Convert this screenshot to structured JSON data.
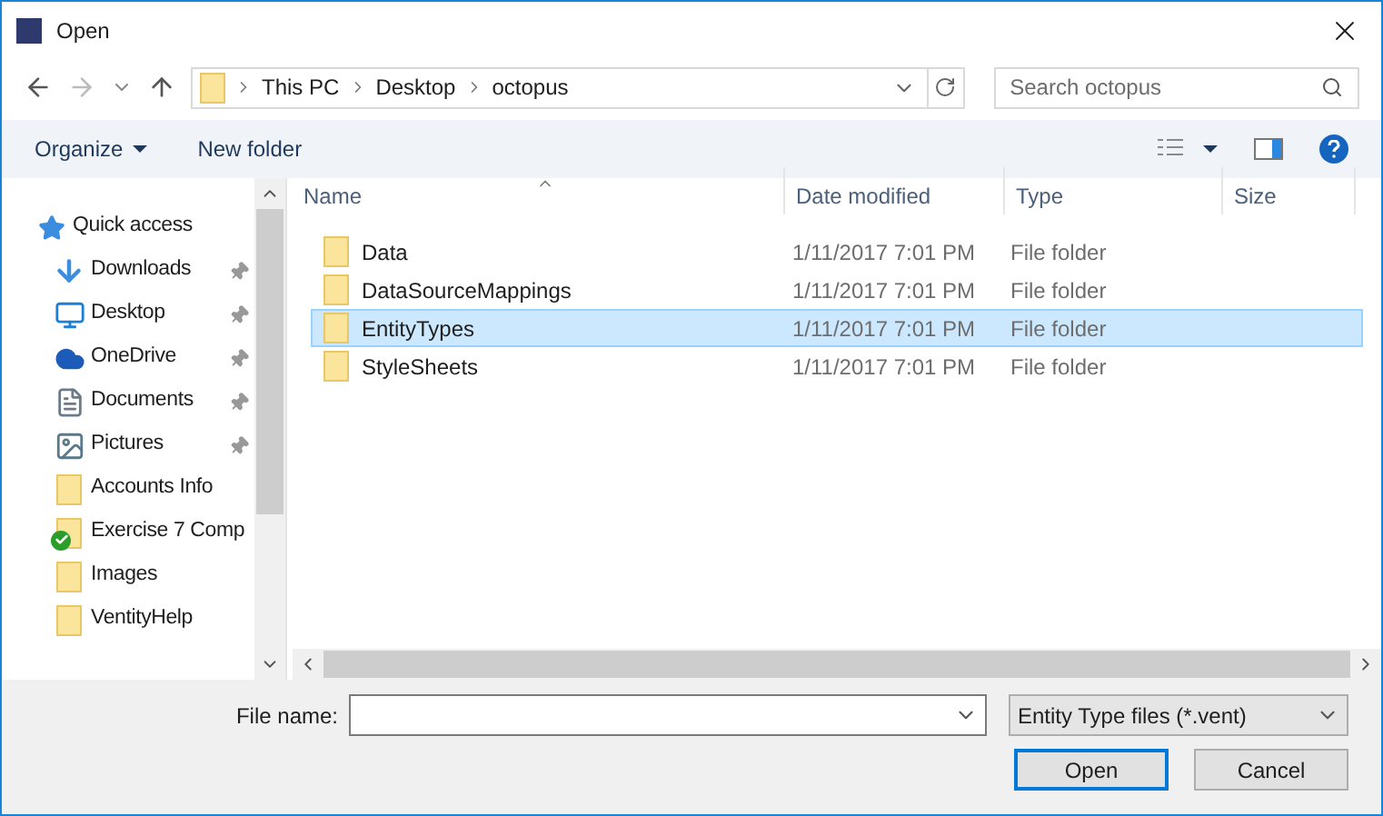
{
  "window": {
    "title": "Open"
  },
  "address_bar": {
    "crumbs": [
      "This PC",
      "Desktop",
      "octopus"
    ]
  },
  "search": {
    "placeholder": "Search octopus"
  },
  "toolbar": {
    "organize": "Organize",
    "new_folder": "New folder"
  },
  "sidebar": {
    "items": [
      {
        "label": "Quick access",
        "kind": "star",
        "pinned": false
      },
      {
        "label": "Downloads",
        "kind": "download",
        "pinned": true
      },
      {
        "label": "Desktop",
        "kind": "desktop",
        "pinned": true
      },
      {
        "label": "OneDrive",
        "kind": "cloud",
        "pinned": true
      },
      {
        "label": "Documents",
        "kind": "document",
        "pinned": true
      },
      {
        "label": "Pictures",
        "kind": "picture",
        "pinned": true
      },
      {
        "label": "Accounts Info",
        "kind": "folder",
        "pinned": false
      },
      {
        "label": "Exercise 7 Comp",
        "kind": "synced-folder",
        "pinned": false
      },
      {
        "label": "Images",
        "kind": "folder",
        "pinned": false
      },
      {
        "label": "VentityHelp",
        "kind": "folder",
        "pinned": false
      }
    ]
  },
  "table": {
    "columns": [
      "Name",
      "Date modified",
      "Type",
      "Size"
    ],
    "rows": [
      {
        "name": "Data",
        "date": "1/11/2017 7:01 PM",
        "type": "File folder",
        "selected": false
      },
      {
        "name": "DataSourceMappings",
        "date": "1/11/2017 7:01 PM",
        "type": "File folder",
        "selected": false
      },
      {
        "name": "EntityTypes",
        "date": "1/11/2017 7:01 PM",
        "type": "File folder",
        "selected": true
      },
      {
        "name": "StyleSheets",
        "date": "1/11/2017 7:01 PM",
        "type": "File folder",
        "selected": false
      }
    ]
  },
  "file_name": {
    "label": "File name:"
  },
  "file_type": {
    "value": "Entity Type files (*.vent)"
  },
  "buttons": {
    "open": "Open",
    "cancel": "Cancel"
  }
}
